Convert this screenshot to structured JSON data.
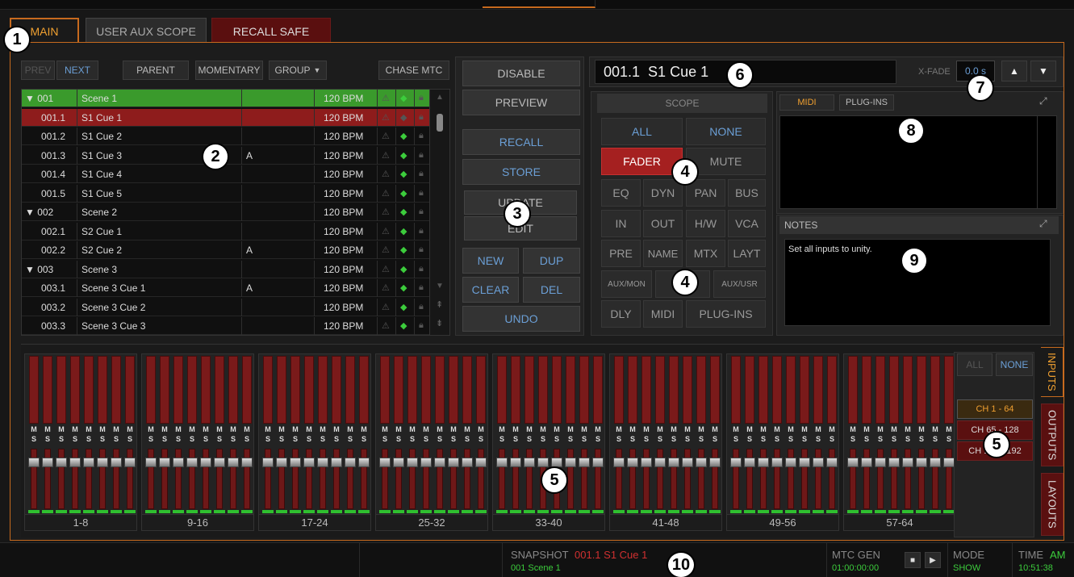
{
  "tabs": {
    "main": "MAIN",
    "aux": "USER AUX SCOPE",
    "recall_safe": "RECALL SAFE"
  },
  "list_toolbar": {
    "prev": "PREV",
    "next": "NEXT",
    "parent": "PARENT",
    "momentary": "MOMENTARY",
    "group": "GROUP",
    "chase": "CHASE MTC"
  },
  "cues": [
    {
      "num": "▼ 001",
      "name": "Scene 1",
      "note": "",
      "bpm": "120 BPM",
      "state": "group-selected"
    },
    {
      "num": "001.1",
      "name": "S1 Cue 1",
      "note": "",
      "bpm": "120 BPM",
      "state": "current"
    },
    {
      "num": "001.2",
      "name": "S1 Cue 2",
      "note": "",
      "bpm": "120 BPM",
      "state": ""
    },
    {
      "num": "001.3",
      "name": "S1 Cue 3",
      "note": "A",
      "bpm": "120 BPM",
      "state": ""
    },
    {
      "num": "001.4",
      "name": "S1 Cue 4",
      "note": "",
      "bpm": "120 BPM",
      "state": ""
    },
    {
      "num": "001.5",
      "name": "S1 Cue 5",
      "note": "",
      "bpm": "120 BPM",
      "state": ""
    },
    {
      "num": "▼ 002",
      "name": "Scene 2",
      "note": "",
      "bpm": "120 BPM",
      "state": ""
    },
    {
      "num": "002.1",
      "name": "S2 Cue 1",
      "note": "",
      "bpm": "120 BPM",
      "state": ""
    },
    {
      "num": "002.2",
      "name": "S2 Cue 2",
      "note": "A",
      "bpm": "120 BPM",
      "state": ""
    },
    {
      "num": "▼ 003",
      "name": "Scene 3",
      "note": "",
      "bpm": "120 BPM",
      "state": ""
    },
    {
      "num": "003.1",
      "name": "Scene 3 Cue 1",
      "note": "A",
      "bpm": "120 BPM",
      "state": ""
    },
    {
      "num": "003.2",
      "name": "Scene 3 Cue 2",
      "note": "",
      "bpm": "120 BPM",
      "state": ""
    },
    {
      "num": "003.3",
      "name": "Scene 3 Cue 3",
      "note": "",
      "bpm": "120 BPM",
      "state": ""
    }
  ],
  "actions": {
    "disable": "DISABLE",
    "preview": "PREVIEW",
    "recall": "RECALL",
    "store": "STORE",
    "update": "UPDATE",
    "edit": "EDIT",
    "new": "NEW",
    "dup": "DUP",
    "clear": "CLEAR",
    "del": "DEL",
    "undo": "UNDO"
  },
  "cue_header": {
    "current": "001.1  S1 Cue 1",
    "xfade_label": "X-FADE",
    "xfade_value": "0.0 s"
  },
  "scope": {
    "title": "SCOPE",
    "all": "ALL",
    "none": "NONE",
    "fader": "FADER",
    "mute": "MUTE",
    "eq": "EQ",
    "dyn": "DYN",
    "pan": "PAN",
    "bus": "BUS",
    "in": "IN",
    "out": "OUT",
    "hw": "H/W",
    "vca": "VCA",
    "pre": "PRE",
    "name": "NAME",
    "mtx": "MTX",
    "layt": "LAYT",
    "auxmon": "AUX/MON",
    "auxusr": "AUX/USR",
    "dly": "DLY",
    "midi": "MIDI",
    "plugins": "PLUG-INS"
  },
  "midi_panel": {
    "midi_tab": "MIDI",
    "plugins_tab": "PLUG-INS"
  },
  "notes": {
    "title": "NOTES",
    "text": "Set all inputs to unity."
  },
  "fader_banks": [
    "1-8",
    "9-16",
    "17-24",
    "25-32",
    "33-40",
    "41-48",
    "49-56",
    "57-64"
  ],
  "strip_labels": {
    "mute": "M",
    "solo": "S"
  },
  "bank_select": {
    "all": "ALL",
    "none": "NONE",
    "ch1": "CH 1 - 64",
    "ch2": "CH 65 - 128",
    "ch3": "CH 129 - 192"
  },
  "side_tabs": {
    "inputs": "INPUTS",
    "outputs": "OUTPUTS",
    "layouts": "LAYOUTS"
  },
  "status": {
    "snapshot_label": "SNAPSHOT",
    "snapshot_current": "001.1 S1 Cue 1",
    "snapshot_scene": "001 Scene 1",
    "mtc_label": "MTC GEN",
    "mtc_value": "01:00:00:00",
    "mode_label": "MODE",
    "mode_value": "SHOW",
    "time_label": "TIME",
    "time_ampm": "AM",
    "time_value": "10:51:38"
  },
  "callouts": [
    "1",
    "2",
    "3",
    "4",
    "4",
    "5",
    "5",
    "5",
    "6",
    "7",
    "8",
    "9",
    "10"
  ],
  "colors": {
    "accent_orange": "#c76a1e",
    "recall_red": "#8e1c1c",
    "active_green": "#3ccc3c",
    "blue_text": "#6b9fd6"
  }
}
